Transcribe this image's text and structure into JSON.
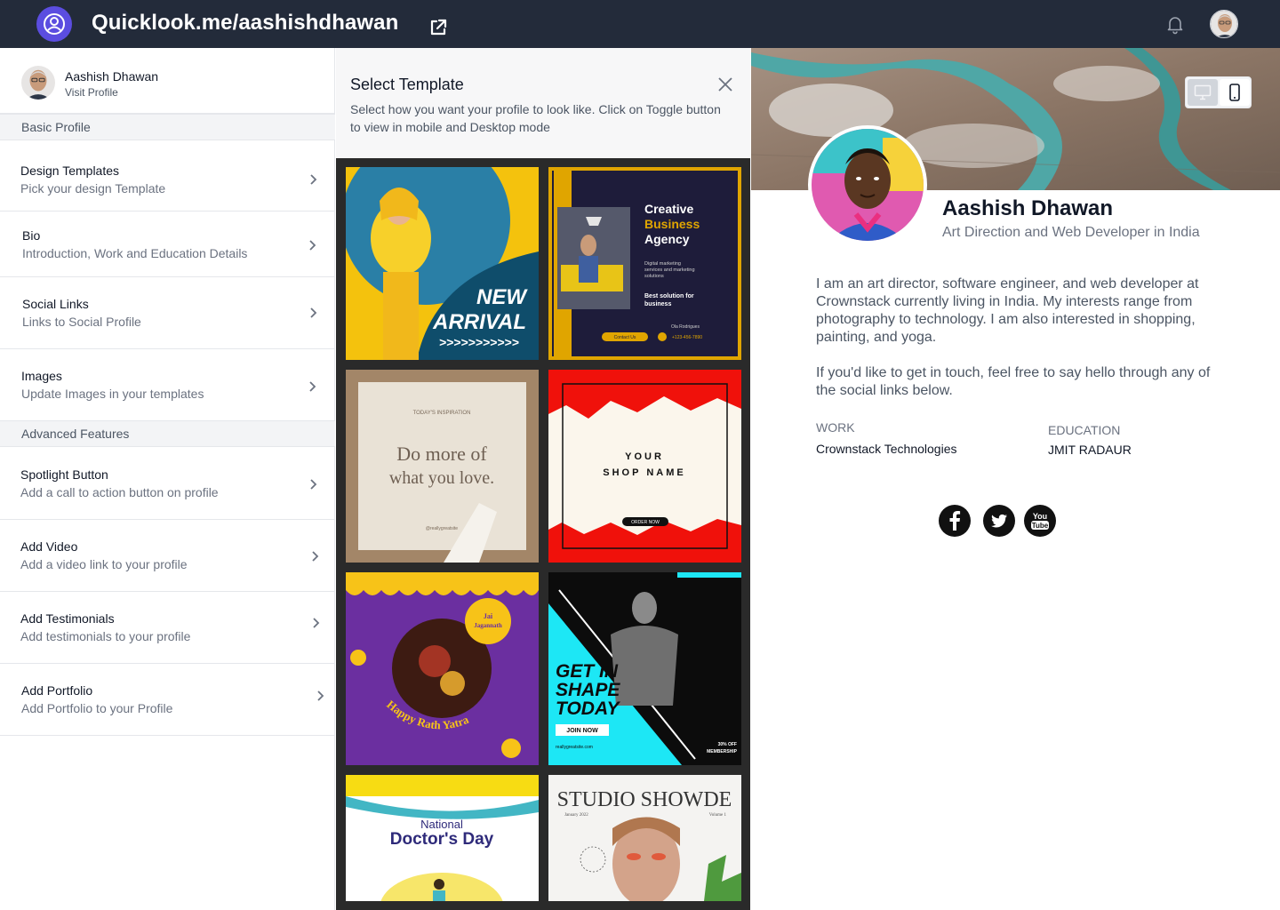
{
  "topbar": {
    "title": "Quicklook.me/aashishdhawan"
  },
  "sidebar": {
    "user": {
      "name": "Aashish Dhawan",
      "link": "Visit  Profile"
    },
    "sections": {
      "basic": "Basic Profile",
      "advanced": "Advanced Features"
    },
    "items": [
      {
        "title": "Design Templates",
        "subtitle": "Pick your design Template"
      },
      {
        "title": "Bio",
        "subtitle": "Introduction, Work and Education Details"
      },
      {
        "title": "Social Links",
        "subtitle": "Links to Social Profile"
      },
      {
        "title": "Images",
        "subtitle": "Update Images in your templates"
      },
      {
        "title": "Spotlight Button",
        "subtitle": "Add a call to action button on profile"
      },
      {
        "title": "Add Video",
        "subtitle": "Add a video link to your profile"
      },
      {
        "title": "Add Testimonials",
        "subtitle": "Add testimonials to your profile"
      },
      {
        "title": "Add Portfolio",
        "subtitle": "Add Portfolio to your Profile"
      }
    ]
  },
  "templates": {
    "title": "Select Template",
    "description": "Select how you want your profile to look like. Click on Toggle button to view in mobile and Desktop mode",
    "cards": {
      "t1": {
        "line1": "NEW",
        "line2": "ARRIVAL",
        "arrows": ">>>>>>>>>>>"
      },
      "t2": {
        "line1": "Creative",
        "line2": "Business",
        "line3": "Agency",
        "small1": "Digital marketing",
        "small2": "services and marketing",
        "small3": "solutions",
        "tag1": "Best solution for",
        "tag2": "business",
        "cta": "Contact Us",
        "phone": "+123-456-7890",
        "person": "Ola Rodrigues"
      },
      "t3": {
        "label": "TODAY'S INSPIRATION",
        "line1": "Do more of",
        "line2": "what you love.",
        "handle": "@reallygreatsite"
      },
      "t4": {
        "line1": "YOUR",
        "line2": "SHOP NAME",
        "cta": "ORDER NOW"
      },
      "t5": {
        "badge1": "Jai",
        "badge2": "Jagannath",
        "arc": "Happy Rath Yatra"
      },
      "t6": {
        "line1": "GET IN",
        "line2": "SHAPE",
        "line3": "TODAY",
        "cta": "JOIN NOW",
        "site": "reallygreatsite.com",
        "off1": "30% OFF",
        "off2": "MEMBERSHIP"
      },
      "t7": {
        "line1": "National",
        "line2": "Doctor's Day"
      },
      "t8": {
        "title": "STUDIO SHOWDE",
        "date": "January 2022",
        "vol": "Volume 1"
      }
    }
  },
  "preview": {
    "name": "Aashish Dhawan",
    "role": "Art Direction and Web Developer in India",
    "bio1": "I am an art director, software engineer, and web developer at Crownstack currently living in India. My interests range from photography to technology. I am also interested in shopping, painting, and yoga.",
    "bio2": "If you'd like to get in touch, feel free to say hello through any of the social links below.",
    "work_label": "WORK",
    "work_value": "Crownstack Technologies",
    "edu_label": "EDUCATION",
    "edu_value": "JMIT RADAUR",
    "social": [
      {
        "name": "facebook",
        "glyph": "f"
      },
      {
        "name": "twitter",
        "glyph": ""
      },
      {
        "name": "youtube",
        "glyph1": "You",
        "glyph2": "Tube"
      }
    ]
  },
  "colors": {
    "topbar": "#232b3a",
    "logo": "#5b4de0",
    "panel_bg": "#2a2a2a"
  }
}
